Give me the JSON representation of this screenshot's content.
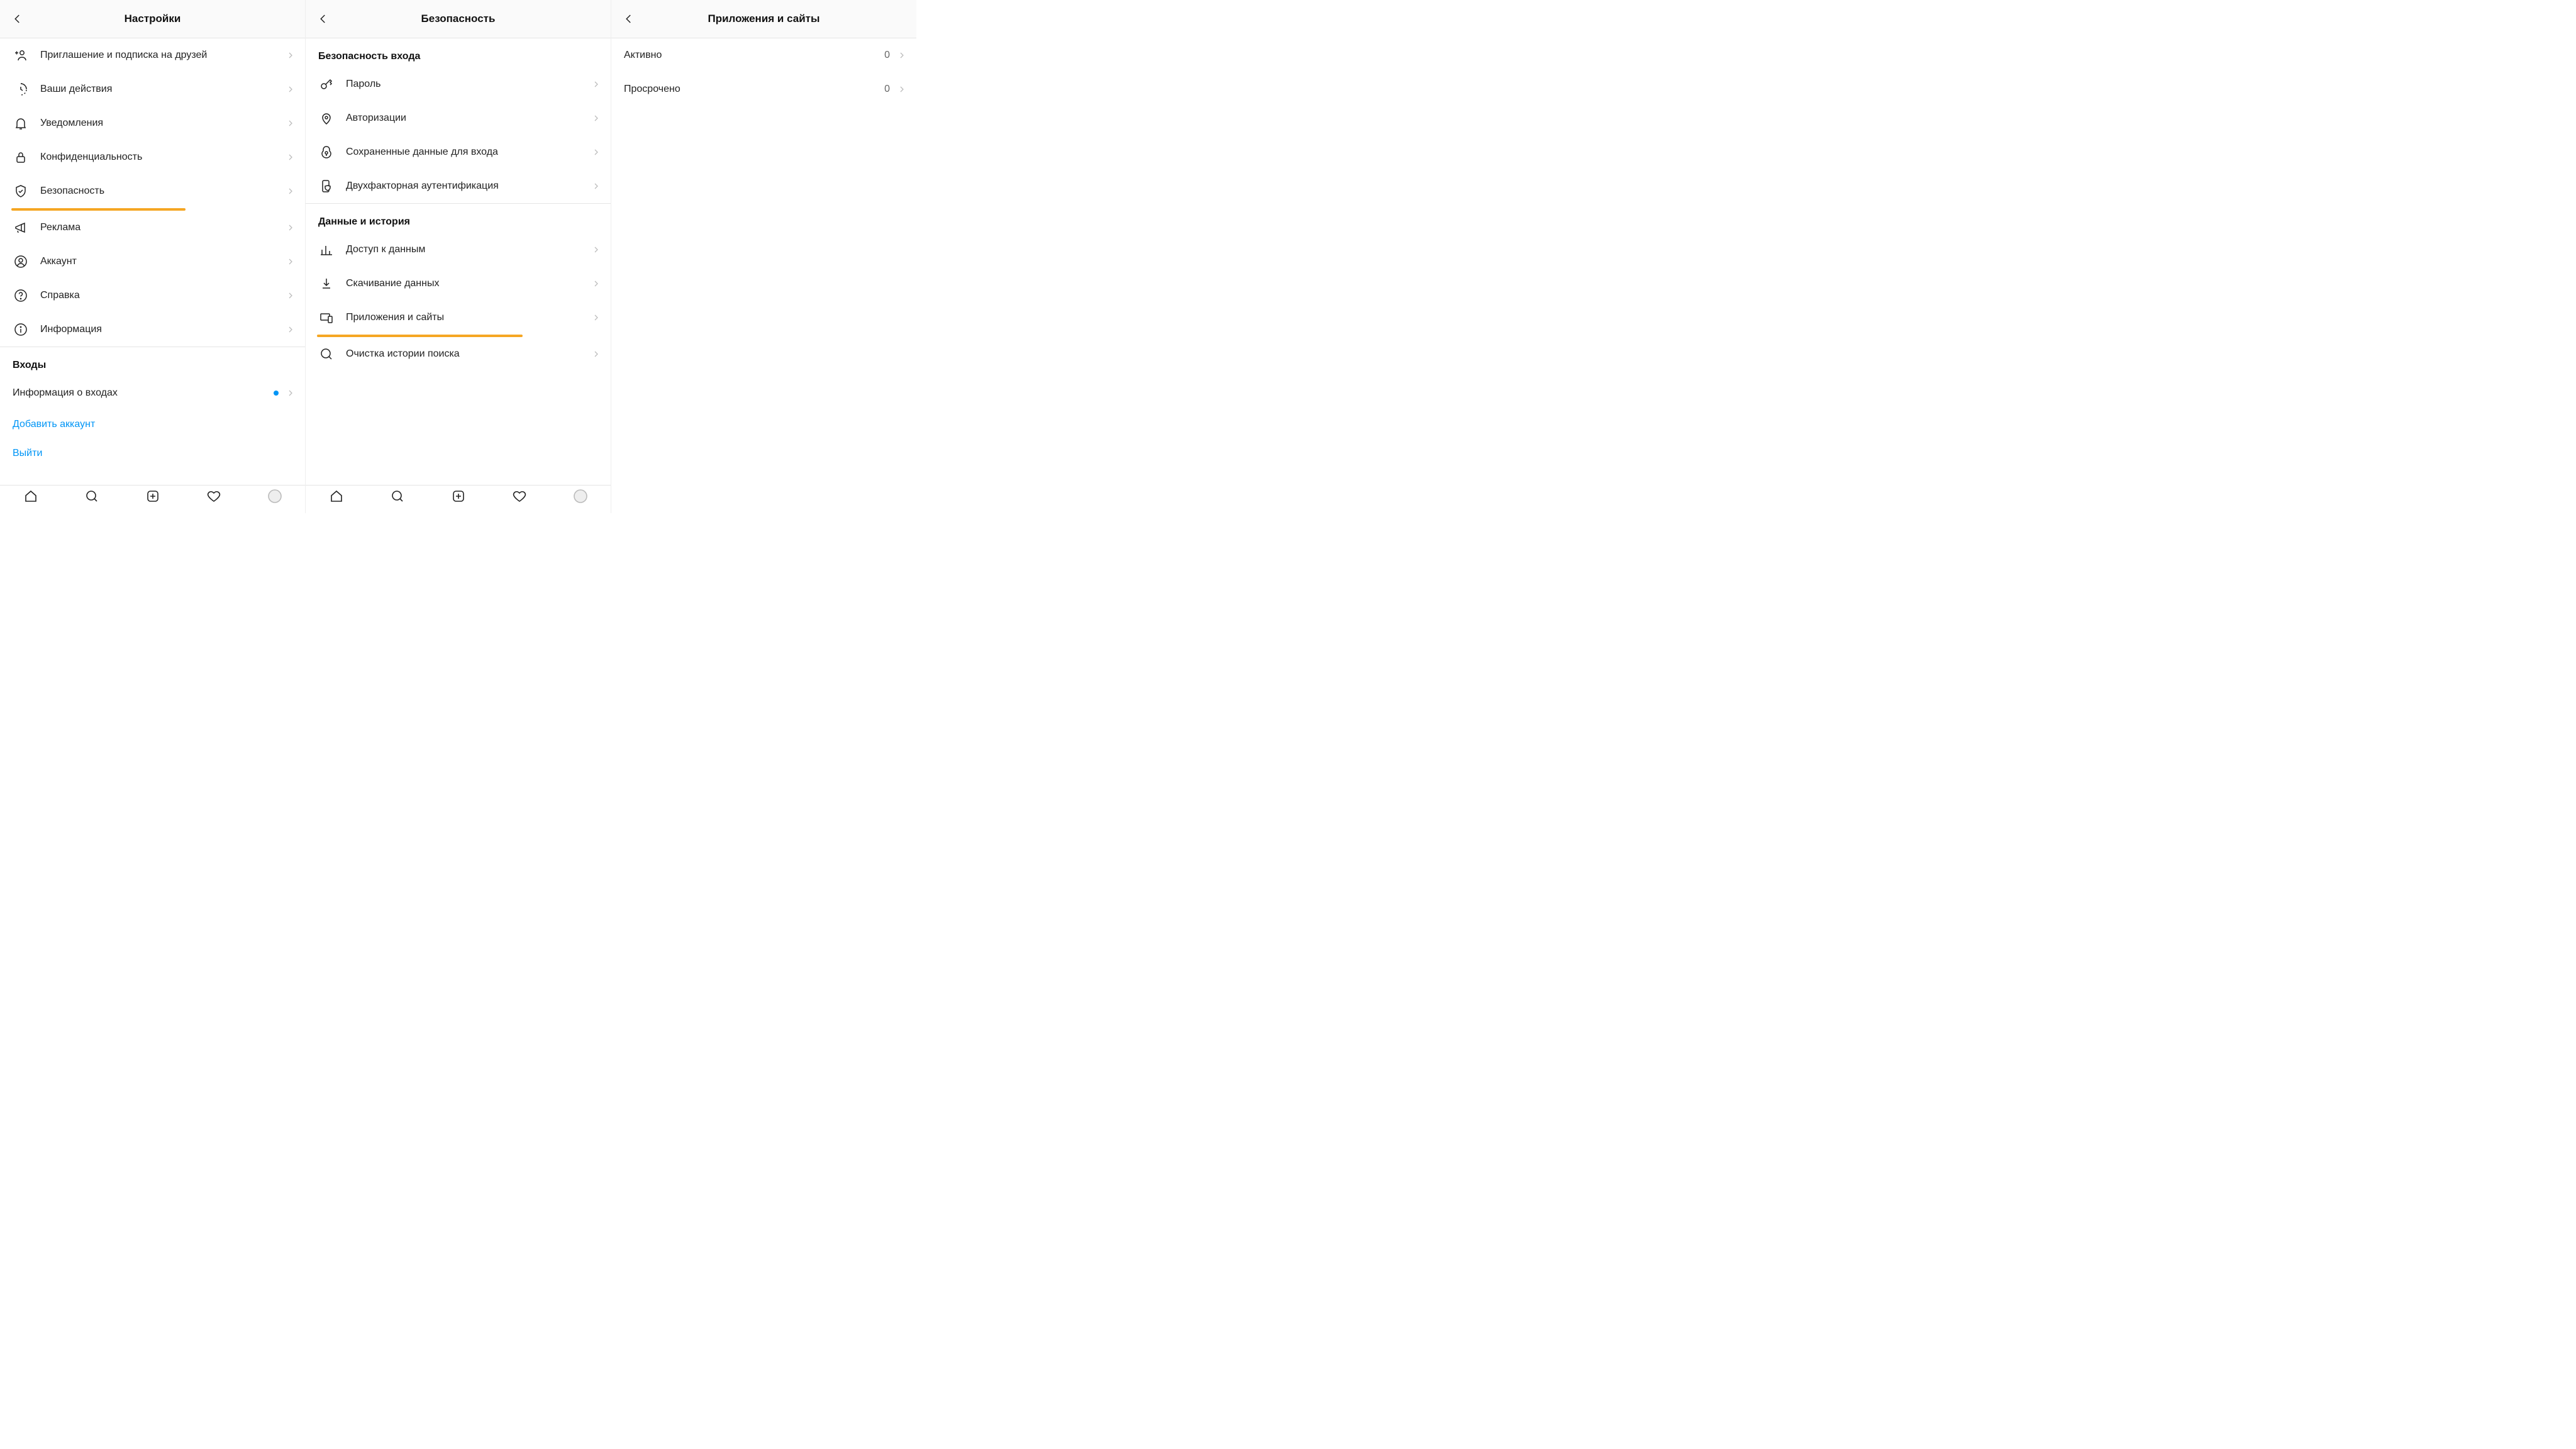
{
  "screens": {
    "settings": {
      "title": "Настройки",
      "items": [
        {
          "label": "Приглашение и подписка на друзей"
        },
        {
          "label": "Ваши действия"
        },
        {
          "label": "Уведомления"
        },
        {
          "label": "Конфиденциальность"
        },
        {
          "label": "Безопасность"
        },
        {
          "label": "Реклама"
        },
        {
          "label": "Аккаунт"
        },
        {
          "label": "Справка"
        },
        {
          "label": "Информация"
        }
      ],
      "logins_section": "Входы",
      "login_info": "Информация о входах",
      "add_account": "Добавить аккаунт",
      "logout": "Выйти"
    },
    "security": {
      "title": "Безопасность",
      "section1": "Безопасность входа",
      "items1": [
        {
          "label": "Пароль"
        },
        {
          "label": "Авторизации"
        },
        {
          "label": "Сохраненные данные для входа"
        },
        {
          "label": "Двухфакторная аутентификация"
        }
      ],
      "section2": "Данные и история",
      "items2": [
        {
          "label": "Доступ к данным"
        },
        {
          "label": "Скачивание данных"
        },
        {
          "label": "Приложения и сайты"
        },
        {
          "label": "Очистка истории поиска"
        }
      ]
    },
    "apps": {
      "title": "Приложения и сайты",
      "rows": [
        {
          "label": "Активно",
          "count": "0"
        },
        {
          "label": "Просрочено",
          "count": "0"
        }
      ]
    }
  },
  "colors": {
    "highlight": "#f5a623",
    "link": "#0095f6"
  }
}
